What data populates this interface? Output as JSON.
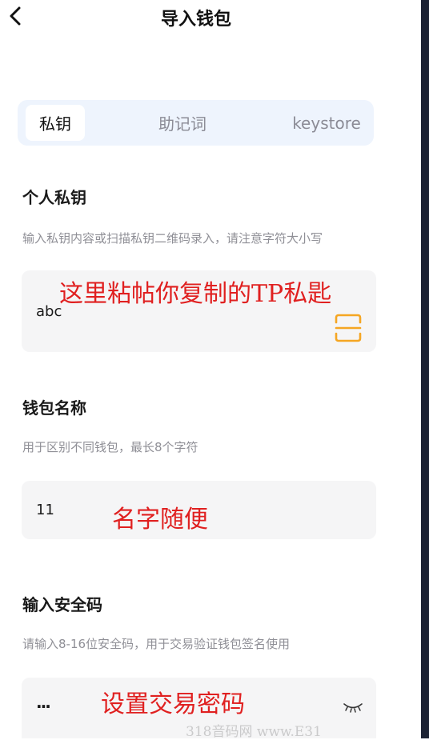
{
  "header": {
    "title": "导入钱包",
    "back_icon": "chevron-left-icon"
  },
  "tabs": [
    {
      "label": "私钥",
      "active": true
    },
    {
      "label": "助记词",
      "active": false
    },
    {
      "label": "keystore",
      "active": false
    }
  ],
  "private_key": {
    "title": "个人私钥",
    "hint": "输入私钥内容或扫描私钥二维码录入，请注意字符大小写",
    "value": "abc",
    "annotation": "这里粘帖你复制的TP私匙",
    "scan_icon": "scan-icon"
  },
  "wallet_name": {
    "title": "钱包名称",
    "hint": "用于区别不同钱包，最长8个字符",
    "value": "11",
    "annotation": "名字随便"
  },
  "security_code": {
    "title": "输入安全码",
    "hint": "请输入8-16位安全码，用于交易验证钱包签名使用",
    "value": "···",
    "annotation": "设置交易密码",
    "eye_icon": "eye-closed-icon"
  },
  "watermark": "318音码网 www.E31",
  "colors": {
    "annotation": "#e02020",
    "scan_accent": "#f5a623",
    "tab_bg": "#eef4fd",
    "field_bg": "#f5f5f6"
  }
}
